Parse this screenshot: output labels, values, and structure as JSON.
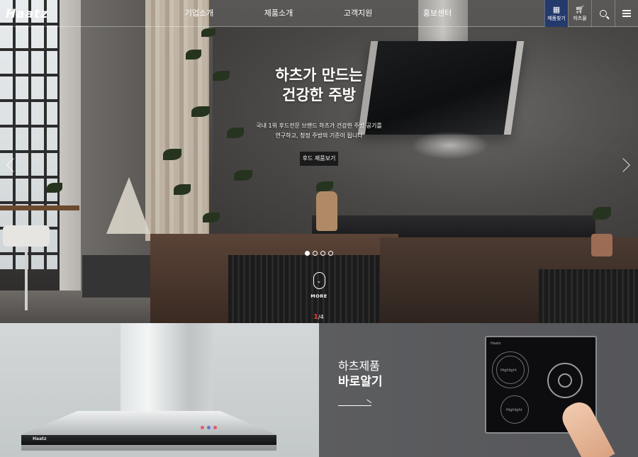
{
  "header": {
    "logo": "Haatz",
    "nav": [
      "기업소개",
      "제품소개",
      "고객지원",
      "홍보센터"
    ],
    "util": {
      "product_find_label": "제품찾기",
      "shop_label": "하츠몰"
    }
  },
  "hero": {
    "title_line1": "하츠가 만드는",
    "title_line2": "건강한 주방",
    "desc_line1": "국내 1위 후드전문 브랜드 하츠가 건강한 주방 공기를",
    "desc_line2": "연구하고, 청정 주방의 기준이 됩니다",
    "cta_label": "후드 제품보기",
    "more_label": "MORE",
    "pager_current": "1",
    "pager_total": "/4",
    "slide_count": 4,
    "active_slide": 1
  },
  "panel_right": {
    "title_line1": "하츠제품",
    "title_line2": "바로알기"
  },
  "product_marks": {
    "hood_logo": "Haatz",
    "cooktop_logo": "Haatz",
    "cooktop_zone1": "Highlight",
    "cooktop_zone2": "Highlight"
  },
  "colors": {
    "accent_blue": "#243a6d",
    "pager_red": "#e63b2e",
    "panel_gray": "#5c5d5f"
  }
}
